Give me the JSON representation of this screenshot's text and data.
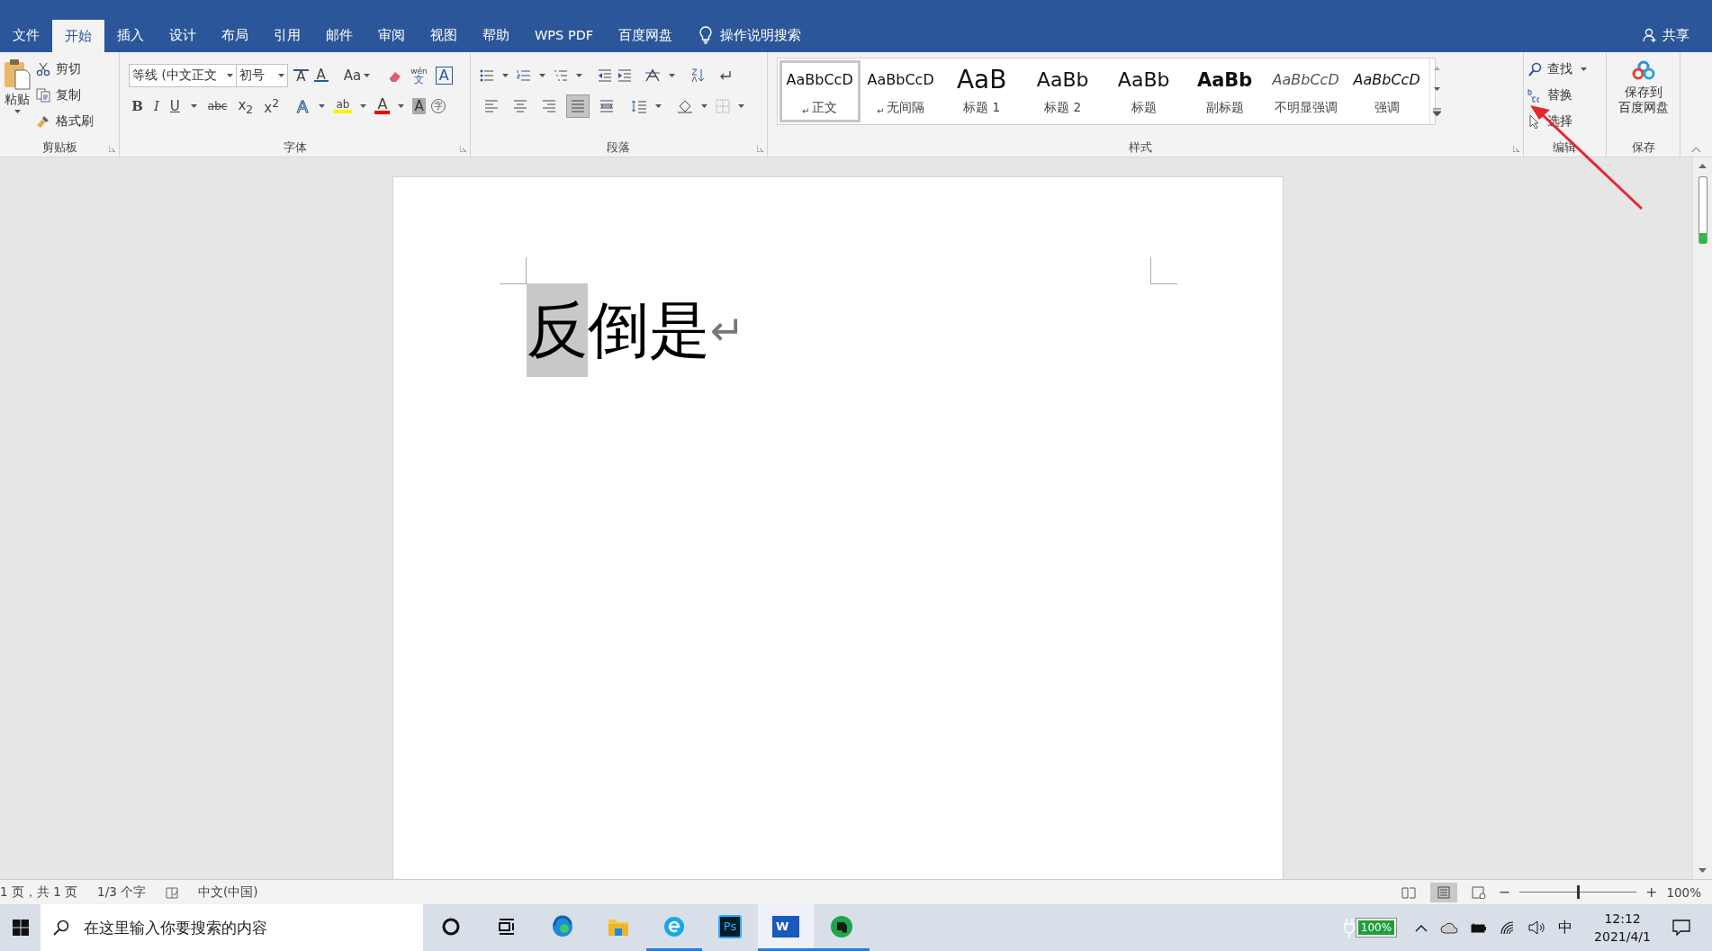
{
  "tabs": [
    {
      "label": "文件",
      "selected": false
    },
    {
      "label": "开始",
      "selected": true
    },
    {
      "label": "插入",
      "selected": false
    },
    {
      "label": "设计",
      "selected": false
    },
    {
      "label": "布局",
      "selected": false
    },
    {
      "label": "引用",
      "selected": false
    },
    {
      "label": "邮件",
      "selected": false
    },
    {
      "label": "审阅",
      "selected": false
    },
    {
      "label": "视图",
      "selected": false
    },
    {
      "label": "帮助",
      "selected": false
    },
    {
      "label": "WPS PDF",
      "selected": false
    },
    {
      "label": "百度网盘",
      "selected": false
    }
  ],
  "tell_me": "操作说明搜索",
  "share": "共享",
  "clipboard": {
    "paste": "粘贴",
    "items": [
      "剪切",
      "复制",
      "格式刷"
    ],
    "label": "剪贴板"
  },
  "font": {
    "name": "等线 (中文正文",
    "size": "初号",
    "grow": "A",
    "shrink": "A",
    "change_case": "Aa",
    "phonetic_top": "wén",
    "phonetic_bottom": "文",
    "border_char": "A",
    "formats": [
      "B",
      "I",
      "U",
      "abc",
      "x$_{2}$",
      "x$^{2}$"
    ],
    "effects": "A",
    "highlight": "ab",
    "font_color": "A",
    "shading": "A",
    "enclose": "字",
    "label": "字体"
  },
  "paragraph": {
    "align": [
      {
        "selected": false
      },
      {
        "selected": false
      },
      {
        "selected": false
      },
      {
        "selected": true
      },
      {
        "selected": false
      }
    ],
    "label": "段落"
  },
  "styles": {
    "items": [
      {
        "kind": "normal",
        "preview": "AaBbCcD",
        "mark": "↵",
        "name": "正文",
        "selected": true
      },
      {
        "kind": "normal",
        "preview": "AaBbCcD",
        "mark": "↵",
        "name": "无间隔",
        "selected": false
      },
      {
        "kind": "heading1",
        "preview": "AaB",
        "name": "标题 1",
        "selected": false
      },
      {
        "kind": "heading2",
        "preview": "AaBb",
        "name": "标题 2",
        "selected": false
      },
      {
        "kind": "title",
        "preview": "AaBb",
        "name": "标题",
        "selected": false
      },
      {
        "kind": "subtitle",
        "preview": "AaBb",
        "name": "副标题",
        "selected": false
      },
      {
        "kind": "subtle",
        "preview": "AaBbCcD",
        "name": "不明显强调",
        "selected": false
      },
      {
        "kind": "emphasis",
        "preview": "AaBbCcD",
        "name": "强调",
        "selected": false
      }
    ],
    "label": "样式"
  },
  "editing": {
    "items": [
      "查找",
      "替换",
      "选择"
    ],
    "label": "编辑"
  },
  "save": {
    "lines": [
      "保存到",
      "百度网盘"
    ],
    "label": "保存"
  },
  "document": {
    "runs": [
      {
        "text": "反",
        "highlighted": true
      },
      {
        "text": "倒是",
        "highlighted": false
      }
    ],
    "paragraph_mark": "↵"
  },
  "status_bar": {
    "page": "1 页，共 1 页",
    "words": "1/3 个字",
    "language": "中文(中国)",
    "zoom_out": "−",
    "zoom": {
      "level": 0.5
    },
    "zoom_in": "+",
    "zoom_value": "100%"
  },
  "taskbar": {
    "search_placeholder": "在这里输入你要搜索的内容",
    "apps": [
      {
        "kind": "cortana",
        "running": false,
        "focused": false
      },
      {
        "kind": "taskview",
        "running": false,
        "focused": false
      },
      {
        "kind": "edge",
        "running": false,
        "focused": false
      },
      {
        "kind": "explorer",
        "running": false,
        "focused": false
      },
      {
        "kind": "ebrowser",
        "running": true,
        "focused": false
      },
      {
        "kind": "photoshop",
        "label": "Ps",
        "running": false,
        "focused": false
      },
      {
        "kind": "word",
        "label": "W",
        "running": true,
        "focused": true
      },
      {
        "kind": "evernote",
        "running": true,
        "focused": false
      }
    ],
    "battery": "100%",
    "ime": "中",
    "time": "12:12",
    "date": "2021/4/1"
  }
}
